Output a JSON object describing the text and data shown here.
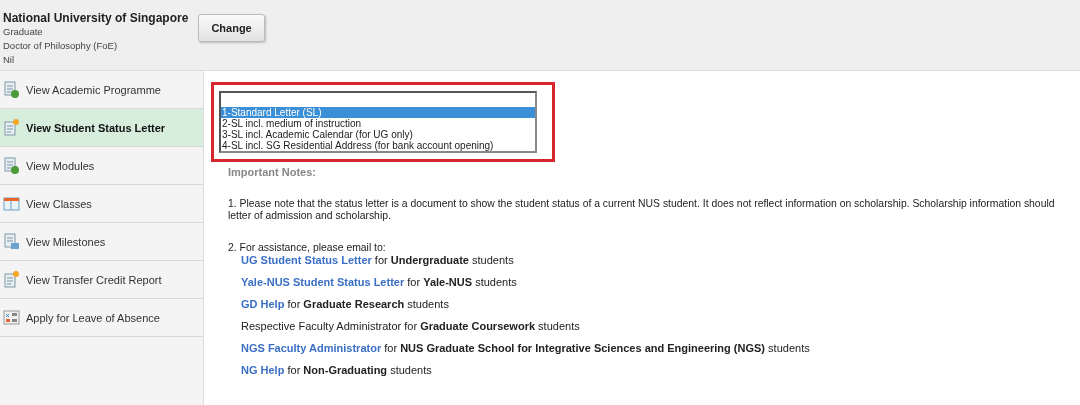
{
  "header": {
    "institution": "National University of Singapore",
    "career": "Graduate",
    "programme": "Doctor of Philosophy (FoE)",
    "plan": "Nil",
    "change_button": "Change"
  },
  "sidebar": {
    "items": [
      {
        "label": "View Academic Programme",
        "kind": "progress",
        "selected": false
      },
      {
        "label": "View Student Status Letter",
        "kind": "letter",
        "selected": true
      },
      {
        "label": "View Modules",
        "kind": "progress",
        "selected": false
      },
      {
        "label": "View Classes",
        "kind": "schedule",
        "selected": false
      },
      {
        "label": "View Milestones",
        "kind": "record",
        "selected": false
      },
      {
        "label": "View Transfer Credit Report",
        "kind": "letter",
        "selected": false
      },
      {
        "label": "Apply for Leave of Absence",
        "kind": "application",
        "selected": false
      }
    ]
  },
  "letter_type_list": {
    "highlighted": true,
    "options": [
      {
        "label": "1-Standard Letter (SL)",
        "selected": true
      },
      {
        "label": "2-SL incl. medium of instruction",
        "selected": false
      },
      {
        "label": "3-SL incl. Academic Calendar (for UG only)",
        "selected": false
      },
      {
        "label": "4-SL incl. SG Residential Address (for bank account opening)",
        "selected": false
      }
    ]
  },
  "notes": {
    "heading": "Important Notes:",
    "note_1": [
      "1. Please note that the status letter is a document to show the student status of a current NUS student. It does not reflect information on scholarship. Scholarship information should",
      "letter of admission and scholarship."
    ],
    "note_2": "2. For assistance, please email to:",
    "contacts": [
      {
        "link": "UG Student Status Letter",
        "text": " for **Undergraduate** students"
      },
      {
        "link": "Yale-NUS Student Status Letter",
        "text": " for **Yale-NUS** students"
      },
      {
        "link": "GD Help",
        "text": " for **Graduate Research** students"
      },
      {
        "text": "Respective Faculty Administrator for **Graduate Coursework** students"
      },
      {
        "link": "NGS Faculty Administrator",
        "text": " for **NUS Graduate School for Integrative Sciences and Engineering (NGS)** students"
      },
      {
        "link": "NG Help",
        "text": " for **Non-Graduating** students"
      }
    ]
  }
}
